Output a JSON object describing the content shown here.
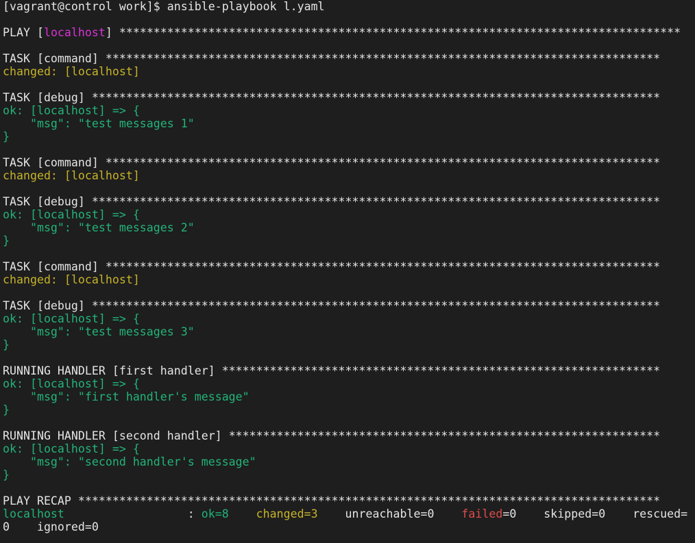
{
  "terminal": {
    "colors": {
      "background": "#1e1e1e",
      "white": "#e5e5e5",
      "magenta": "#d534d5",
      "yellow": "#c7b32a",
      "green": "#23b479",
      "red": "#e04b4b"
    },
    "lines": [
      [
        {
          "text": "[vagrant@control work]$ ansible-playbook l.yaml",
          "color": "white"
        }
      ],
      [],
      [
        {
          "text": "PLAY [",
          "color": "white"
        },
        {
          "text": "localhost",
          "color": "magenta"
        },
        {
          "text": "] ",
          "color": "white"
        },
        {
          "text": "**********************************************************************************",
          "color": "white"
        }
      ],
      [],
      [
        {
          "text": "TASK [command] ",
          "color": "white"
        },
        {
          "text": "*********************************************************************************",
          "color": "white"
        }
      ],
      [
        {
          "text": "changed: [localhost]",
          "color": "yellow"
        }
      ],
      [],
      [
        {
          "text": "TASK [debug] ",
          "color": "white"
        },
        {
          "text": "***********************************************************************************",
          "color": "white"
        }
      ],
      [
        {
          "text": "ok: [localhost] => {",
          "color": "green"
        }
      ],
      [
        {
          "text": "    \"msg\": \"test messages 1\"",
          "color": "green"
        }
      ],
      [
        {
          "text": "}",
          "color": "green"
        }
      ],
      [],
      [
        {
          "text": "TASK [command] ",
          "color": "white"
        },
        {
          "text": "*********************************************************************************",
          "color": "white"
        }
      ],
      [
        {
          "text": "changed: [localhost]",
          "color": "yellow"
        }
      ],
      [],
      [
        {
          "text": "TASK [debug] ",
          "color": "white"
        },
        {
          "text": "***********************************************************************************",
          "color": "white"
        }
      ],
      [
        {
          "text": "ok: [localhost] => {",
          "color": "green"
        }
      ],
      [
        {
          "text": "    \"msg\": \"test messages 2\"",
          "color": "green"
        }
      ],
      [
        {
          "text": "}",
          "color": "green"
        }
      ],
      [],
      [
        {
          "text": "TASK [command] ",
          "color": "white"
        },
        {
          "text": "*********************************************************************************",
          "color": "white"
        }
      ],
      [
        {
          "text": "changed: [localhost]",
          "color": "yellow"
        }
      ],
      [],
      [
        {
          "text": "TASK [debug] ",
          "color": "white"
        },
        {
          "text": "***********************************************************************************",
          "color": "white"
        }
      ],
      [
        {
          "text": "ok: [localhost] => {",
          "color": "green"
        }
      ],
      [
        {
          "text": "    \"msg\": \"test messages 3\"",
          "color": "green"
        }
      ],
      [
        {
          "text": "}",
          "color": "green"
        }
      ],
      [],
      [
        {
          "text": "RUNNING HANDLER [first handler] ",
          "color": "white"
        },
        {
          "text": "****************************************************************",
          "color": "white"
        }
      ],
      [
        {
          "text": "ok: [localhost] => {",
          "color": "green"
        }
      ],
      [
        {
          "text": "    \"msg\": \"first handler's message\"",
          "color": "green"
        }
      ],
      [
        {
          "text": "}",
          "color": "green"
        }
      ],
      [],
      [
        {
          "text": "RUNNING HANDLER [second handler] ",
          "color": "white"
        },
        {
          "text": "***************************************************************",
          "color": "white"
        }
      ],
      [
        {
          "text": "ok: [localhost] => {",
          "color": "green"
        }
      ],
      [
        {
          "text": "    \"msg\": \"second handler's message\"",
          "color": "green"
        }
      ],
      [
        {
          "text": "}",
          "color": "green"
        }
      ],
      [],
      [
        {
          "text": "PLAY RECAP ",
          "color": "white"
        },
        {
          "text": "*************************************************************************************",
          "color": "white"
        }
      ],
      [
        {
          "text": "localhost",
          "color": "green"
        },
        {
          "text": "                  : ",
          "color": "white"
        },
        {
          "text": "ok=8",
          "color": "green"
        },
        {
          "text": "    ",
          "color": "white"
        },
        {
          "text": "changed=3",
          "color": "yellow"
        },
        {
          "text": "    unreachable=0    ",
          "color": "white"
        },
        {
          "text": "failed",
          "color": "red"
        },
        {
          "text": "=0    skipped=0    rescued=",
          "color": "white"
        }
      ],
      [
        {
          "text": "0    ignored=0",
          "color": "white"
        }
      ]
    ]
  }
}
